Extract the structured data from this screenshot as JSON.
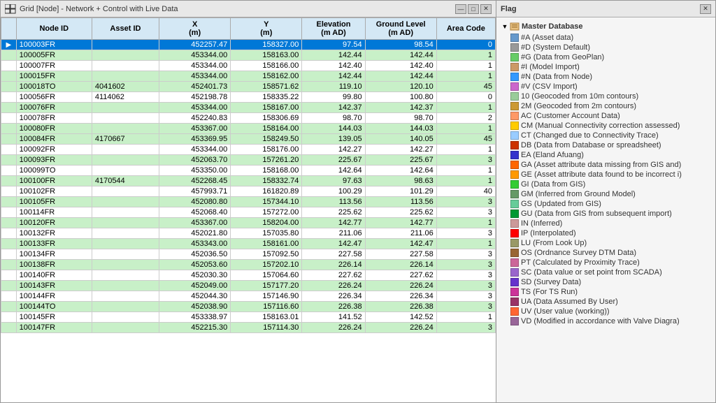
{
  "grid": {
    "title": "Grid [Node] - Network + Control with Live Data",
    "columns": [
      {
        "key": "indicator",
        "label": "",
        "class": "col-indicator"
      },
      {
        "key": "nodeid",
        "label": "Node ID",
        "class": "col-nodeid"
      },
      {
        "key": "assetid",
        "label": "Asset ID",
        "class": "col-assetid"
      },
      {
        "key": "x",
        "label": "X\n(m)",
        "class": "col-x"
      },
      {
        "key": "y",
        "label": "Y\n(m)",
        "class": "col-y"
      },
      {
        "key": "elevation",
        "label": "Elevation\n(m AD)",
        "class": "col-elevation"
      },
      {
        "key": "groundlevel",
        "label": "Ground Level\n(m AD)",
        "class": "col-groundlevel"
      },
      {
        "key": "areacode",
        "label": "Area Code",
        "class": "col-areacode"
      }
    ],
    "rows": [
      {
        "indicator": "▶",
        "nodeid": "100003FR",
        "assetid": "",
        "x": "452257.47",
        "y": "158327.00",
        "elevation": "97.54",
        "groundlevel": "98.54",
        "areacode": "0",
        "rowclass": "row-selected"
      },
      {
        "indicator": "",
        "nodeid": "100005FR",
        "assetid": "",
        "x": "453344.00",
        "y": "158163.00",
        "elevation": "142.44",
        "groundlevel": "142.44",
        "areacode": "1",
        "rowclass": "row-green"
      },
      {
        "indicator": "",
        "nodeid": "100007FR",
        "assetid": "",
        "x": "453344.00",
        "y": "158166.00",
        "elevation": "142.40",
        "groundlevel": "142.40",
        "areacode": "1",
        "rowclass": "row-white"
      },
      {
        "indicator": "",
        "nodeid": "100015FR",
        "assetid": "",
        "x": "453344.00",
        "y": "158162.00",
        "elevation": "142.44",
        "groundlevel": "142.44",
        "areacode": "1",
        "rowclass": "row-green"
      },
      {
        "indicator": "",
        "nodeid": "100018TO",
        "assetid": "4041602",
        "x": "452401.73",
        "y": "158571.62",
        "elevation": "119.10",
        "groundlevel": "120.10",
        "areacode": "45",
        "rowclass": "row-green"
      },
      {
        "indicator": "",
        "nodeid": "100056FR",
        "assetid": "4114062",
        "x": "452198.78",
        "y": "158335.22",
        "elevation": "99.80",
        "groundlevel": "100.80",
        "areacode": "0",
        "rowclass": "row-white"
      },
      {
        "indicator": "",
        "nodeid": "100076FR",
        "assetid": "",
        "x": "453344.00",
        "y": "158167.00",
        "elevation": "142.37",
        "groundlevel": "142.37",
        "areacode": "1",
        "rowclass": "row-green"
      },
      {
        "indicator": "",
        "nodeid": "100078FR",
        "assetid": "",
        "x": "452240.83",
        "y": "158306.69",
        "elevation": "98.70",
        "groundlevel": "98.70",
        "areacode": "2",
        "rowclass": "row-white"
      },
      {
        "indicator": "",
        "nodeid": "100080FR",
        "assetid": "",
        "x": "453367.00",
        "y": "158164.00",
        "elevation": "144.03",
        "groundlevel": "144.03",
        "areacode": "1",
        "rowclass": "row-green"
      },
      {
        "indicator": "",
        "nodeid": "100084FR",
        "assetid": "4170667",
        "x": "453369.95",
        "y": "158249.50",
        "elevation": "139.05",
        "groundlevel": "140.05",
        "areacode": "45",
        "rowclass": "row-green"
      },
      {
        "indicator": "",
        "nodeid": "100092FR",
        "assetid": "",
        "x": "453344.00",
        "y": "158176.00",
        "elevation": "142.27",
        "groundlevel": "142.27",
        "areacode": "1",
        "rowclass": "row-white"
      },
      {
        "indicator": "",
        "nodeid": "100093FR",
        "assetid": "",
        "x": "452063.70",
        "y": "157261.20",
        "elevation": "225.67",
        "groundlevel": "225.67",
        "areacode": "3",
        "rowclass": "row-green"
      },
      {
        "indicator": "",
        "nodeid": "100099TO",
        "assetid": "",
        "x": "453350.00",
        "y": "158168.00",
        "elevation": "142.64",
        "groundlevel": "142.64",
        "areacode": "1",
        "rowclass": "row-white"
      },
      {
        "indicator": "",
        "nodeid": "100100FR",
        "assetid": "4170544",
        "x": "452268.45",
        "y": "158332.74",
        "elevation": "97.63",
        "groundlevel": "98.63",
        "areacode": "1",
        "rowclass": "row-green"
      },
      {
        "indicator": "",
        "nodeid": "100102FR",
        "assetid": "",
        "x": "457993.71",
        "y": "161820.89",
        "elevation": "100.29",
        "groundlevel": "101.29",
        "areacode": "40",
        "rowclass": "row-white"
      },
      {
        "indicator": "",
        "nodeid": "100105FR",
        "assetid": "",
        "x": "452080.80",
        "y": "157344.10",
        "elevation": "113.56",
        "groundlevel": "113.56",
        "areacode": "3",
        "rowclass": "row-green"
      },
      {
        "indicator": "",
        "nodeid": "100114FR",
        "assetid": "",
        "x": "452068.40",
        "y": "157272.00",
        "elevation": "225.62",
        "groundlevel": "225.62",
        "areacode": "3",
        "rowclass": "row-white"
      },
      {
        "indicator": "",
        "nodeid": "100120FR",
        "assetid": "",
        "x": "453367.00",
        "y": "158204.00",
        "elevation": "142.77",
        "groundlevel": "142.77",
        "areacode": "1",
        "rowclass": "row-green"
      },
      {
        "indicator": "",
        "nodeid": "100132FR",
        "assetid": "",
        "x": "452021.80",
        "y": "157035.80",
        "elevation": "211.06",
        "groundlevel": "211.06",
        "areacode": "3",
        "rowclass": "row-white"
      },
      {
        "indicator": "",
        "nodeid": "100133FR",
        "assetid": "",
        "x": "453343.00",
        "y": "158161.00",
        "elevation": "142.47",
        "groundlevel": "142.47",
        "areacode": "1",
        "rowclass": "row-green"
      },
      {
        "indicator": "",
        "nodeid": "100134FR",
        "assetid": "",
        "x": "452036.50",
        "y": "157092.50",
        "elevation": "227.58",
        "groundlevel": "227.58",
        "areacode": "3",
        "rowclass": "row-white"
      },
      {
        "indicator": "",
        "nodeid": "100138FR",
        "assetid": "",
        "x": "452053.60",
        "y": "157202.10",
        "elevation": "226.14",
        "groundlevel": "226.14",
        "areacode": "3",
        "rowclass": "row-green"
      },
      {
        "indicator": "",
        "nodeid": "100140FR",
        "assetid": "",
        "x": "452030.30",
        "y": "157064.60",
        "elevation": "227.62",
        "groundlevel": "227.62",
        "areacode": "3",
        "rowclass": "row-white"
      },
      {
        "indicator": "",
        "nodeid": "100143FR",
        "assetid": "",
        "x": "452049.00",
        "y": "157177.20",
        "elevation": "226.24",
        "groundlevel": "226.24",
        "areacode": "3",
        "rowclass": "row-green"
      },
      {
        "indicator": "",
        "nodeid": "100144FR",
        "assetid": "",
        "x": "452044.30",
        "y": "157146.90",
        "elevation": "226.34",
        "groundlevel": "226.34",
        "areacode": "3",
        "rowclass": "row-white"
      },
      {
        "indicator": "",
        "nodeid": "100144TO",
        "assetid": "",
        "x": "452038.90",
        "y": "157116.60",
        "elevation": "226.38",
        "groundlevel": "226.38",
        "areacode": "3",
        "rowclass": "row-green"
      },
      {
        "indicator": "",
        "nodeid": "100145FR",
        "assetid": "",
        "x": "453338.97",
        "y": "158163.01",
        "elevation": "141.52",
        "groundlevel": "142.52",
        "areacode": "1",
        "rowclass": "row-white"
      },
      {
        "indicator": "",
        "nodeid": "100147FR",
        "assetid": "",
        "x": "452215.30",
        "y": "157114.30",
        "elevation": "226.24",
        "groundlevel": "226.24",
        "areacode": "3",
        "rowclass": "row-green"
      }
    ]
  },
  "flag": {
    "title": "Flag",
    "close_label": "✕",
    "tree": {
      "root_label": "Master Database",
      "items": [
        {
          "code": "#A",
          "desc": "Asset data",
          "color": "#6699cc",
          "indent": 1
        },
        {
          "code": "#D",
          "desc": "System Default",
          "color": "#999999",
          "indent": 1
        },
        {
          "code": "#G",
          "desc": "Data from GeoPlan",
          "color": "#66cc66",
          "indent": 1
        },
        {
          "code": "#I",
          "desc": "Model Import",
          "color": "#cc9966",
          "indent": 1
        },
        {
          "code": "#N",
          "desc": "Data from Node",
          "color": "#3399ff",
          "indent": 1
        },
        {
          "code": "#V",
          "desc": "CSV Import",
          "color": "#cc66cc",
          "indent": 1
        },
        {
          "code": "10",
          "desc": "Geocoded from 10m contours",
          "color": "#99cc99",
          "indent": 1
        },
        {
          "code": "2M",
          "desc": "Geocoded from 2m contours",
          "color": "#cc9933",
          "indent": 1
        },
        {
          "code": "AC",
          "desc": "Customer Account Data",
          "color": "#ff9966",
          "indent": 1
        },
        {
          "code": "CM",
          "desc": "Manual Connectivity correction assessed",
          "color": "#ffcc00",
          "indent": 1
        },
        {
          "code": "CT",
          "desc": "Changed due to Connectivity Trace",
          "color": "#99ccff",
          "indent": 1
        },
        {
          "code": "DB",
          "desc": "Data from Database or spreadsheet",
          "color": "#cc3300",
          "indent": 1
        },
        {
          "code": "EA",
          "desc": "Eland Afuang",
          "color": "#3333cc",
          "indent": 1
        },
        {
          "code": "GA",
          "desc": "Asset attribute data missing from GIS and",
          "color": "#ff6600",
          "indent": 1
        },
        {
          "code": "GE",
          "desc": "Asset attribute data found to be incorrect i",
          "color": "#ff9900",
          "indent": 1
        },
        {
          "code": "GI",
          "desc": "Data from GIS",
          "color": "#33cc33",
          "indent": 1
        },
        {
          "code": "GM",
          "desc": "Inferred from Ground Model",
          "color": "#669966",
          "indent": 1
        },
        {
          "code": "GS",
          "desc": "Updated from GIS",
          "color": "#66cc99",
          "indent": 1
        },
        {
          "code": "GU",
          "desc": "Data from GIS from subsequent import",
          "color": "#009933",
          "indent": 1
        },
        {
          "code": "IN",
          "desc": "Inferred",
          "color": "#cc9999",
          "indent": 1
        },
        {
          "code": "IP",
          "desc": "Interpolated",
          "color": "#ff0000",
          "indent": 1
        },
        {
          "code": "LU",
          "desc": "From Look Up",
          "color": "#999966",
          "indent": 1
        },
        {
          "code": "OS",
          "desc": "Ordnance Survey DTM Data",
          "color": "#996633",
          "indent": 1
        },
        {
          "code": "PT",
          "desc": "Calculated by Proximity Trace",
          "color": "#cc6699",
          "indent": 1
        },
        {
          "code": "SC",
          "desc": "Data value or set point from SCADA",
          "color": "#9966cc",
          "indent": 1
        },
        {
          "code": "SD",
          "desc": "Survey Data",
          "color": "#6633cc",
          "indent": 1
        },
        {
          "code": "TS",
          "desc": "For TS Run",
          "color": "#cc3399",
          "indent": 1
        },
        {
          "code": "UA",
          "desc": "Data Assumed By User",
          "color": "#993366",
          "indent": 1
        },
        {
          "code": "UV",
          "desc": "User value (working)",
          "color": "#ff6633",
          "indent": 1
        },
        {
          "code": "VD",
          "desc": "Modified in accordance with Valve Diagra",
          "color": "#996699",
          "indent": 1
        }
      ]
    }
  }
}
